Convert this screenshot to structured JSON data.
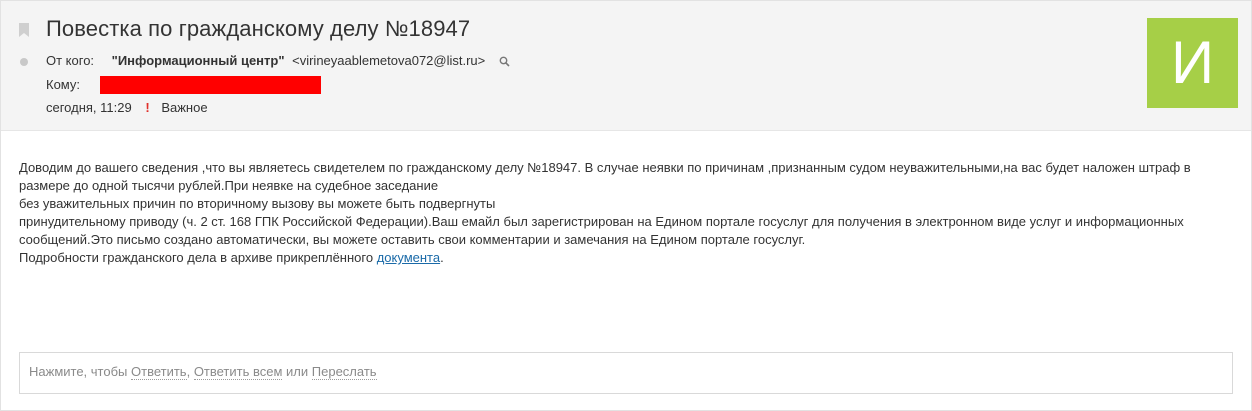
{
  "message": {
    "subject": "Повестка по гражданскому делу №18947",
    "from_label": "От кого:",
    "sender_name": "\"Информационный центр\"",
    "sender_email": "<virineyaablemetova072@list.ru>",
    "to_label": "Кому:",
    "date": "сегодня, 11:29",
    "importance_mark": "!",
    "importance_label": "Важное",
    "avatar_letter": "И",
    "avatar_color": "#a6cf47"
  },
  "body": {
    "line1": "Доводим до вашего сведения ,что вы являетесь свидетелем по гражданскому делу №18947. В случае неявки по причинам ,признанным судом неуважительными,на вас будет наложен штраф в",
    "line2": "размере до одной тысячи рублей.При неявке на судебное заседание",
    "line3": "без уважительных причин по вторичному вызову вы можете быть подвергнуты",
    "line4": "принудительному приводу (ч. 2 ст. 168 ГПК Российской Федерации).Ваш емайл был зарегистрирован на Едином портале госуслуг  для получения в электронном виде  услуг и информационных",
    "line5": "сообщений.Это письмо создано автоматически, вы можете оставить свои комментарии и замечания  на Едином портале госуслуг.",
    "line6_prefix": "Подробности гражданского дела в архиве прикреплённого ",
    "line6_link": "документа",
    "line6_suffix": "."
  },
  "reply": {
    "prefix": "Нажмите, чтобы ",
    "reply": "Ответить",
    "sep1": ", ",
    "reply_all": "Ответить всем",
    "sep2": " или ",
    "forward": "Переслать"
  },
  "colors": {
    "redaction": "#ff0000",
    "link": "#1a6aa8",
    "importance": "#e0302b"
  }
}
